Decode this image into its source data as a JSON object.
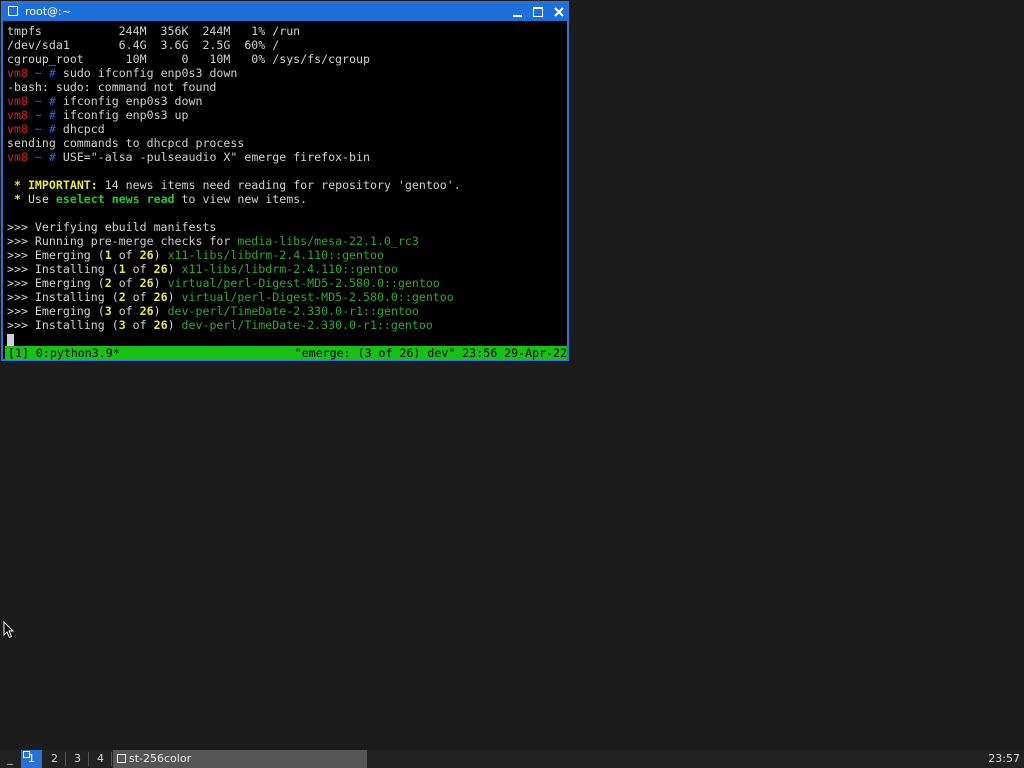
{
  "window": {
    "title": "root@:~",
    "controls": [
      "minimize-icon",
      "maximize-icon",
      "close-icon"
    ]
  },
  "terminal": {
    "lines": [
      [
        {
          "t": "tmpfs           244M  356K  244M   1% /run",
          "c": "white"
        }
      ],
      [
        {
          "t": "/dev/sda1       6.4G  3.6G  2.5G  60% /",
          "c": "white"
        }
      ],
      [
        {
          "t": "cgroup_root      10M     0   10M   0% /sys/fs/cgroup",
          "c": "white"
        }
      ],
      [
        {
          "t": "vm8",
          "c": "red"
        },
        {
          "t": " ~ # ",
          "c": "blue"
        },
        {
          "t": "sudo ifconfig enp0s3 down",
          "c": "white"
        }
      ],
      [
        {
          "t": "-bash: sudo: command not found",
          "c": "white"
        }
      ],
      [
        {
          "t": "vm8",
          "c": "red"
        },
        {
          "t": " ~ # ",
          "c": "blue"
        },
        {
          "t": "ifconfig enp0s3 down",
          "c": "white"
        }
      ],
      [
        {
          "t": "vm8",
          "c": "red"
        },
        {
          "t": " ~ # ",
          "c": "blue"
        },
        {
          "t": "ifconfig enp0s3 up",
          "c": "white"
        }
      ],
      [
        {
          "t": "vm8",
          "c": "red"
        },
        {
          "t": " ~ # ",
          "c": "blue"
        },
        {
          "t": "dhcpcd",
          "c": "white"
        }
      ],
      [
        {
          "t": "sending commands to dhcpcd process",
          "c": "white"
        }
      ],
      [
        {
          "t": "vm8",
          "c": "red"
        },
        {
          "t": " ~ # ",
          "c": "blue"
        },
        {
          "t": "USE=\"-alsa -pulseaudio X\" emerge firefox-bin",
          "c": "white"
        }
      ],
      [
        {
          "t": "",
          "c": "white"
        }
      ],
      [
        {
          "t": " * ",
          "c": "yellow"
        },
        {
          "t": "IMPORTANT:",
          "c": "yellow"
        },
        {
          "t": " 14 news items need reading for repository 'gentoo'.",
          "c": "white"
        }
      ],
      [
        {
          "t": " * ",
          "c": "yellow"
        },
        {
          "t": "Use ",
          "c": "white"
        },
        {
          "t": "eselect news read",
          "c": "bgreen"
        },
        {
          "t": " to view new items.",
          "c": "white"
        }
      ],
      [
        {
          "t": "",
          "c": "white"
        }
      ],
      [
        {
          "t": ">>> Verifying ebuild manifests",
          "c": "white"
        }
      ],
      [
        {
          "t": ">>> Running pre-merge checks for ",
          "c": "white"
        },
        {
          "t": "media-libs/mesa-22.1.0_rc3",
          "c": "green"
        }
      ],
      [
        {
          "t": ">>> Emerging (",
          "c": "white"
        },
        {
          "t": "1",
          "c": "yellow"
        },
        {
          "t": " of ",
          "c": "white"
        },
        {
          "t": "26",
          "c": "yellow"
        },
        {
          "t": ") ",
          "c": "white"
        },
        {
          "t": "x11-libs/libdrm-2.4.110::gentoo",
          "c": "green"
        }
      ],
      [
        {
          "t": ">>> Installing (",
          "c": "white"
        },
        {
          "t": "1",
          "c": "yellow"
        },
        {
          "t": " of ",
          "c": "white"
        },
        {
          "t": "26",
          "c": "yellow"
        },
        {
          "t": ") ",
          "c": "white"
        },
        {
          "t": "x11-libs/libdrm-2.4.110::gentoo",
          "c": "green"
        }
      ],
      [
        {
          "t": ">>> Emerging (",
          "c": "white"
        },
        {
          "t": "2",
          "c": "yellow"
        },
        {
          "t": " of ",
          "c": "white"
        },
        {
          "t": "26",
          "c": "yellow"
        },
        {
          "t": ") ",
          "c": "white"
        },
        {
          "t": "virtual/perl-Digest-MD5-2.580.0::gentoo",
          "c": "green"
        }
      ],
      [
        {
          "t": ">>> Installing (",
          "c": "white"
        },
        {
          "t": "2",
          "c": "yellow"
        },
        {
          "t": " of ",
          "c": "white"
        },
        {
          "t": "26",
          "c": "yellow"
        },
        {
          "t": ") ",
          "c": "white"
        },
        {
          "t": "virtual/perl-Digest-MD5-2.580.0::gentoo",
          "c": "green"
        }
      ],
      [
        {
          "t": ">>> Emerging (",
          "c": "white"
        },
        {
          "t": "3",
          "c": "yellow"
        },
        {
          "t": " of ",
          "c": "white"
        },
        {
          "t": "26",
          "c": "yellow"
        },
        {
          "t": ") ",
          "c": "white"
        },
        {
          "t": "dev-perl/TimeDate-2.330.0-r1::gentoo",
          "c": "green"
        }
      ],
      [
        {
          "t": ">>> Installing (",
          "c": "white"
        },
        {
          "t": "3",
          "c": "yellow"
        },
        {
          "t": " of ",
          "c": "white"
        },
        {
          "t": "26",
          "c": "yellow"
        },
        {
          "t": ") ",
          "c": "white"
        },
        {
          "t": "dev-perl/TimeDate-2.330.0-r1::gentoo",
          "c": "green"
        }
      ]
    ]
  },
  "tmux_status": {
    "left": "[1] 0:python3.9*",
    "right": "\"emerge: (3 of 26) dev\" 23:56 29-Apr-22"
  },
  "taskbar": {
    "menu_label": "_",
    "workspaces": [
      "1",
      "2",
      "3",
      "4"
    ],
    "active_workspace": "1",
    "task_label": "st-256color",
    "clock": "23:57"
  },
  "colors": {
    "titlebar": "#1f6fd8",
    "status_bar": "#18c018",
    "prompt_host": "#d81c1c",
    "prompt_path": "#3b5bdb",
    "package": "#2fa82f",
    "highlight": "#e8e84a"
  }
}
